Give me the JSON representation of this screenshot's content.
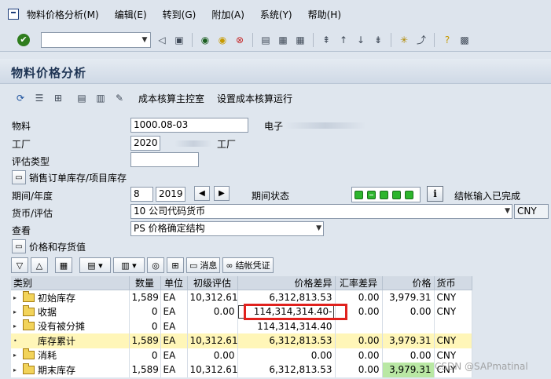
{
  "menu": [
    "物料价格分析(M)",
    "编辑(E)",
    "转到(G)",
    "附加(A)",
    "系统(Y)",
    "帮助(H)"
  ],
  "title": "物料价格分析",
  "app_toolbar": {
    "btn1": "成本核算主控室",
    "btn2": "设置成本核算运行"
  },
  "form": {
    "material_label": "物料",
    "material_value": "1000.08-03",
    "material_desc": "电子",
    "plant_label": "工厂",
    "plant_value": "2020",
    "plant_desc": "工厂",
    "valuation_label": "评估类型",
    "valuation_value": "",
    "sales_order_btn": "销售订单库存/项目库存",
    "period_label": "期间/年度",
    "period_value": "8",
    "year_value": "2019",
    "period_status_label": "期间状态",
    "period_status_text": "结帐输入已完成",
    "currency_label": "货币/评估",
    "currency_value": "10 公司代码货币",
    "currency_code": "CNY",
    "view_label": "查看",
    "view_value": "PS 价格确定结构",
    "price_stock_btn": "价格和存货值"
  },
  "grid_toolbar": {
    "message_btn": "消息",
    "voucher_btn": "结帐凭证"
  },
  "table": {
    "headers": [
      "类别",
      "数量",
      "单位",
      "初级评估",
      "价格差异",
      "汇率差异",
      "价格",
      "货币"
    ],
    "rows": [
      [
        "初始库存",
        "1,589",
        "EA",
        "10,312.61",
        "6,312,813.53",
        "0.00",
        "3,979.31",
        "CNY"
      ],
      [
        "收据",
        "0",
        "EA",
        "0.00",
        "114,314,314.40-",
        "0.00",
        "0.00",
        "CNY"
      ],
      [
        "没有被分摊",
        "0",
        "EA",
        "",
        "114,314,314.40",
        "",
        "",
        ""
      ],
      [
        "库存累计",
        "1,589",
        "EA",
        "10,312.61",
        "6,312,813.53",
        "0.00",
        "3,979.31",
        "CNY"
      ],
      [
        "消耗",
        "0",
        "EA",
        "0.00",
        "0.00",
        "0.00",
        "0.00",
        "CNY"
      ],
      [
        "期末库存",
        "1,589",
        "EA",
        "10,312.61",
        "6,312,813.53",
        "0.00",
        "3,979.31",
        "CNY"
      ]
    ]
  },
  "watermark": "CSDN @SAPmatinal"
}
